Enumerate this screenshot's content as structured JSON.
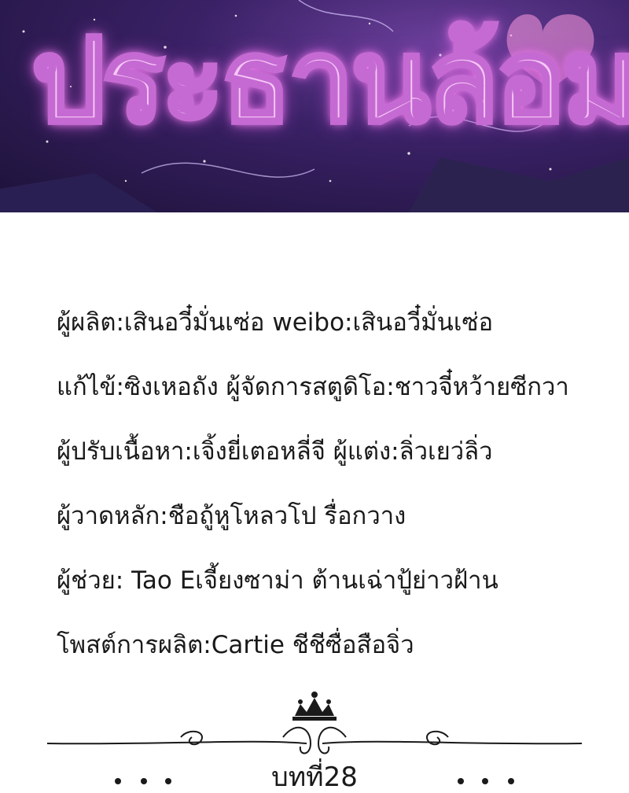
{
  "banner": {
    "title": "ประธานล้อมรัก"
  },
  "credits": [
    "ผู้ผลิต:เสินอวี๋มั่นเซ่อ  weibo:เสินอวี๋มั่นเซ่อ",
    "แก้ไข้:ซิงเหอถัง   ผู้จัดการสตูดิโอ:ชาวจี๋หว้ายซีกวา",
    "ผู้ปรับเนื้อหา:เจิ้งยี่เตอหลี่จี  ผู้แต่ง:ลิ่วเยว่ลิ่ว",
    "ผู้วาดหลัก:ชือถู้หูโหลวโป  รื่อกวาง",
    "ผู้ช่วย: Tao Eเจี้ยงซาม่า ต้านเฉ่าปู้ย่าวฝ้าน",
    "โพสต์การผลิต:Cartie ชีชีซื่อสือจิ่ว"
  ],
  "chapter_label": "บทที่28",
  "colors": {
    "banner_bg": "#3a2166",
    "title_fill": "#f6c8f6",
    "title_stroke": "#c56ad3",
    "text": "#1a1a1a"
  },
  "icons": [
    "crown-ornament-icon",
    "scroll-divider-icon",
    "fleur-dot-icon"
  ]
}
